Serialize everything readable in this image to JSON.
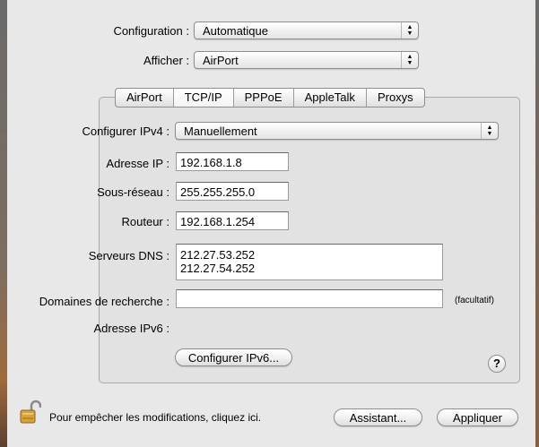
{
  "top": {
    "configuration_label": "Configuration :",
    "configuration_value": "Automatique",
    "afficher_label": "Afficher :",
    "afficher_value": "AirPort"
  },
  "tabs": [
    {
      "label": "AirPort",
      "selected": false
    },
    {
      "label": "TCP/IP",
      "selected": true
    },
    {
      "label": "PPPoE",
      "selected": false
    },
    {
      "label": "AppleTalk",
      "selected": false
    },
    {
      "label": "Proxys",
      "selected": false
    }
  ],
  "tcpip": {
    "configurer_ipv4_label": "Configurer IPv4 :",
    "configurer_ipv4_value": "Manuellement",
    "adresse_ip_label": "Adresse IP :",
    "adresse_ip_value": "192.168.1.8",
    "sous_reseau_label": "Sous-réseau :",
    "sous_reseau_value": "255.255.255.0",
    "routeur_label": "Routeur :",
    "routeur_value": "192.168.1.254",
    "dns_label": "Serveurs DNS :",
    "dns_values": [
      "212.27.53.252",
      "212.27.54.252"
    ],
    "domaines_label": "Domaines de recherche :",
    "domaines_value": "",
    "facultatif": "(facultatif)",
    "adresse_ipv6_label": "Adresse IPv6 :",
    "configurer_ipv6_button": "Configurer IPv6...",
    "help_glyph": "?"
  },
  "footer": {
    "lock_icon": "lock-open-icon",
    "lock_text": "Pour empêcher les modifications, cliquez ici.",
    "assistant_button": "Assistant...",
    "appliquer_button": "Appliquer"
  }
}
